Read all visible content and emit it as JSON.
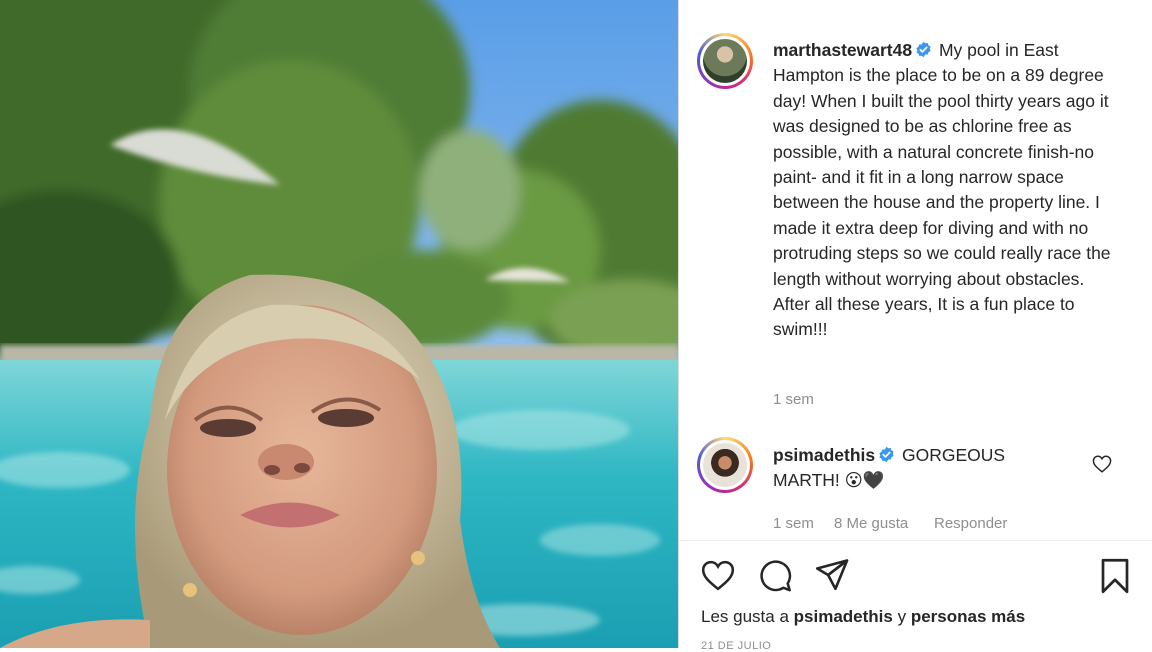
{
  "post": {
    "author": "marthastewart48",
    "caption": "My pool in East Hampton is the place to be on a 89 degree day! When I built the pool thirty years ago it was designed to be as chlorine free as possible, with a natural concrete finish-no paint- and it fit in a long narrow space between the house and the property line. I made it extra deep for diving and with no protruding steps so we could really race the length without worrying about obstacles. After all these years, It is a fun place to swim!!!",
    "time_ago": "1 sem",
    "date": "21 DE JULIO"
  },
  "comments": [
    {
      "author": "psimadethis",
      "text": "GORGEOUS MARTH! 😮🖤",
      "time_ago": "1 sem",
      "likes": "8 Me gusta",
      "reply_label": "Responder"
    }
  ],
  "likes": {
    "prefix": "Les gusta a",
    "user": "psimadethis",
    "connector": "y",
    "others": "personas más"
  },
  "icons": {
    "verified": "verified-badge-icon",
    "like": "heart-icon",
    "comment": "speech-bubble-icon",
    "share": "paper-plane-icon",
    "save": "bookmark-icon",
    "comment_like": "small-heart-icon"
  },
  "colors": {
    "verified": "#3897f0",
    "text": "#262626",
    "muted": "#8e8e8e",
    "border": "#dbdbdb"
  }
}
